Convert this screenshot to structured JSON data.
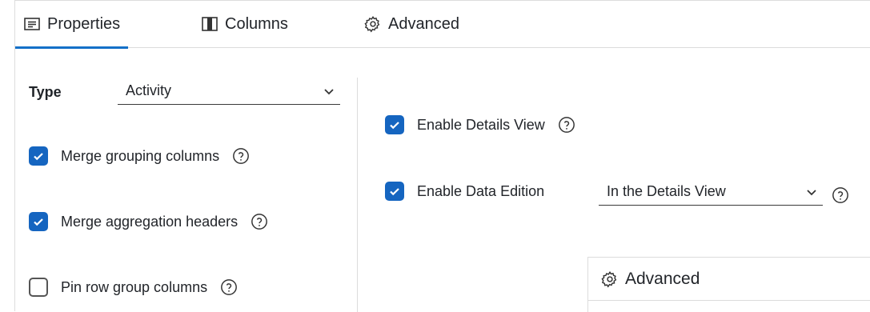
{
  "tabs": [
    {
      "label": "Properties",
      "icon": "properties-icon",
      "active": true
    },
    {
      "label": "Columns",
      "icon": "columns-icon",
      "active": false
    },
    {
      "label": "Advanced",
      "icon": "gear-icon",
      "active": false
    }
  ],
  "left": {
    "type_label": "Type",
    "type_value": "Activity",
    "options": [
      {
        "label": "Merge grouping columns",
        "checked": true
      },
      {
        "label": "Merge aggregation headers",
        "checked": true
      },
      {
        "label": "Pin row group columns",
        "checked": false
      }
    ]
  },
  "right": {
    "details_view": {
      "label": "Enable Details View",
      "checked": true
    },
    "data_edition": {
      "label": "Enable Data Edition",
      "checked": true,
      "select_value": "In the Details View"
    }
  },
  "advanced_panel": {
    "title": "Advanced",
    "icon": "gear-icon"
  },
  "colors": {
    "accent": "#1565c0",
    "tab_underline": "#1470c8",
    "border": "#dcdcdc"
  }
}
